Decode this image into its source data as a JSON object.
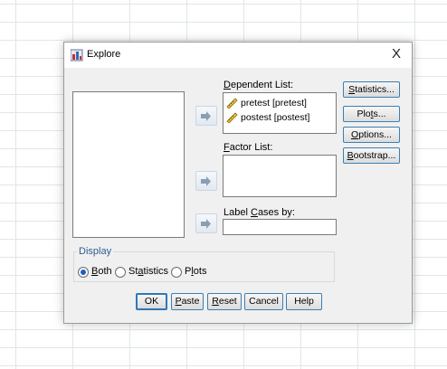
{
  "dialog": {
    "title": "Explore",
    "close_glyph": "X",
    "title_icon": "explore-icon"
  },
  "lists": {
    "dependent_label": {
      "pre": "",
      "key": "D",
      "post": "ependent List:"
    },
    "dependent_items": [
      "pretest [pretest]",
      "postest [postest]"
    ],
    "factor_label": {
      "pre": "",
      "key": "F",
      "post": "actor List:"
    },
    "label_cases_label": {
      "pre": "Label ",
      "key": "C",
      "post": "ases by:"
    }
  },
  "side_buttons": [
    {
      "pre": "",
      "key": "S",
      "post": "tatistics..."
    },
    {
      "pre": "Plo",
      "key": "t",
      "post": "s..."
    },
    {
      "pre": "",
      "key": "O",
      "post": "ptions..."
    },
    {
      "pre": "",
      "key": "B",
      "post": "ootstrap..."
    }
  ],
  "display": {
    "legend": "Display",
    "options": [
      {
        "pre": "",
        "key": "B",
        "post": "oth",
        "selected": true
      },
      {
        "pre": "St",
        "key": "a",
        "post": "tistics",
        "selected": false
      },
      {
        "pre": "P",
        "key": "l",
        "post": "ots",
        "selected": false
      }
    ]
  },
  "bottom_buttons": [
    {
      "pre": "OK",
      "key": "",
      "post": ""
    },
    {
      "pre": "",
      "key": "P",
      "post": "aste"
    },
    {
      "pre": "",
      "key": "R",
      "post": "eset"
    },
    {
      "pre": "Cancel",
      "key": "",
      "post": ""
    },
    {
      "pre": "Help",
      "key": "",
      "post": ""
    }
  ],
  "colors": {
    "accent_border": "#3c7fb1",
    "legend_text": "#2a5d8c",
    "radio_selected": "#1e5cc8"
  }
}
